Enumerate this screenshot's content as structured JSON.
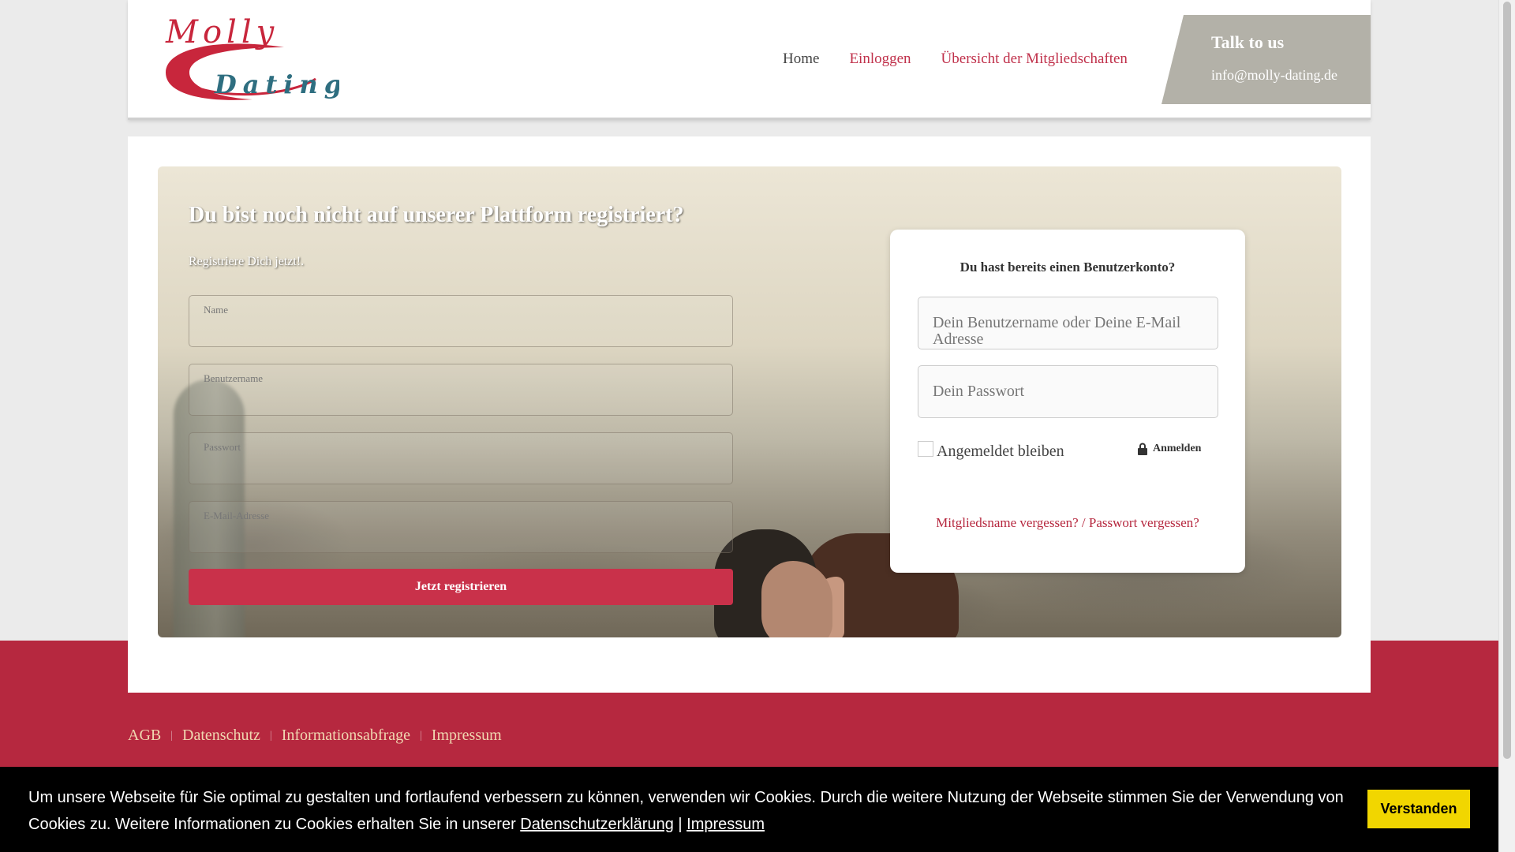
{
  "logo": {
    "line1": "Molly",
    "line2": "Dating",
    "red": "#c8263c",
    "teal": "#2e6e80"
  },
  "nav": {
    "home": "Home",
    "login": "Einloggen",
    "memberships": "Übersicht der Mitgliedschaften"
  },
  "talk": {
    "title": "Talk to us",
    "email": "info@molly-dating.de"
  },
  "register": {
    "title": "Du bist noch nicht auf unserer Plattform registriert?",
    "subtitle": "Registriere Dich jetzt!.",
    "fields": {
      "name": "Name",
      "username": "Benutzername",
      "password": "Passwort",
      "email": "E-Mail-Adresse"
    },
    "button": "Jetzt registrieren"
  },
  "login": {
    "title": "Du hast bereits einen Benutzerkonto?",
    "username_placeholder": "Dein Benutzername oder Deine E-Mail Adresse",
    "password_placeholder": "Dein Passwort",
    "remember": "Angemeldet bleiben",
    "button": "Anmelden",
    "forgot_username": "Mitgliedsname vergessen?",
    "forgot_separator": " / ",
    "forgot_password": "Passwort vergessen?"
  },
  "footer": {
    "agb": "AGB",
    "privacy": "Datenschutz",
    "info": "Informationsabfrage",
    "imprint": "Impressum",
    "separator": "|"
  },
  "cookie": {
    "text": "Um unsere Webseite für Sie optimal zu gestalten und fortlaufend verbessern zu können, verwenden wir Cookies. Durch die weitere Nutzung der Webseite stimmen Sie der Verwendung von Cookies zu. Weitere Informationen zu Cookies erhalten Sie in unserer ",
    "privacy_link": "Datenschutzerklärung",
    "separator": " | ",
    "imprint_link": "Impressum",
    "button": "Verstanden"
  },
  "colors": {
    "accent": "#b6283f",
    "button_red": "#c9314a",
    "cookie_button": "#f1d600",
    "talk_bg": "#b3b1a8"
  }
}
